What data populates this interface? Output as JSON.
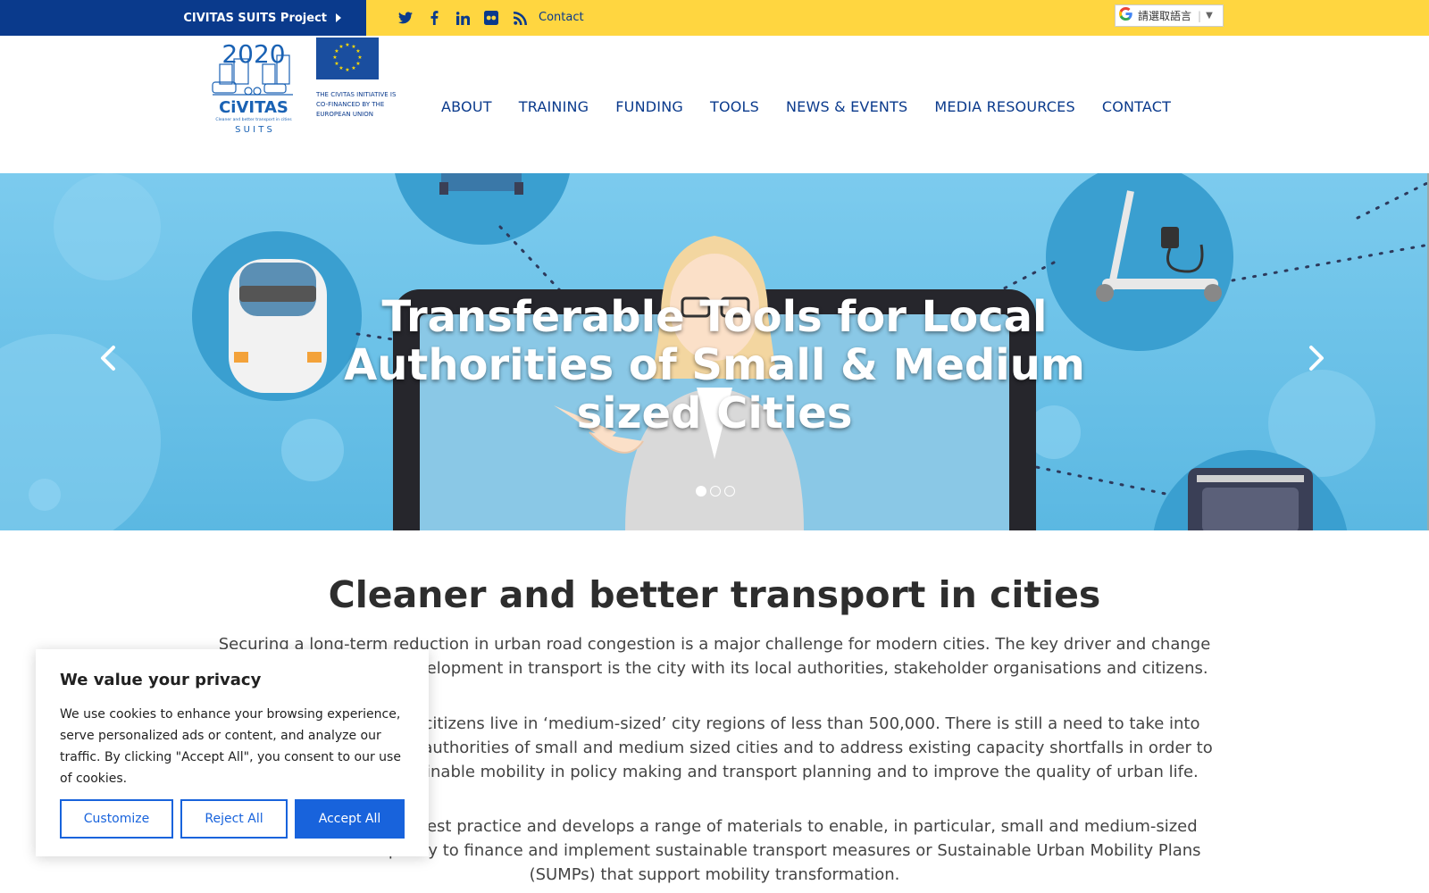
{
  "topbar": {
    "project_label": "CIVITAS SUITS Project",
    "social_icons": [
      "twitter-icon",
      "facebook-icon",
      "linkedin-icon",
      "flickr-icon",
      "rss-icon"
    ],
    "contact_label": "Contact",
    "translate_label": "請選取語言",
    "translate_arrow": "▼"
  },
  "header": {
    "civitas_year": "2020",
    "civitas_name": "CiVITAS",
    "civitas_tagline": "Cleaner and better transport in cities",
    "civitas_sub": "S U I T S",
    "eu_text": "THE CIVITAS INITIATIVE IS CO-FINANCED BY THE EUROPEAN UNION",
    "nav": [
      "ABOUT",
      "TRAINING",
      "FUNDING",
      "TOOLS",
      "NEWS & EVENTS",
      "MEDIA RESOURCES",
      "CONTACT"
    ]
  },
  "hero": {
    "title": "Transferable Tools for Local Authorities of Small & Medium sized Cities",
    "slide_count": 3,
    "active_slide": 1
  },
  "content": {
    "heading": "Cleaner and better transport in cities",
    "p1": "Securing a long-term reduction in urban road congestion is a major challenge for modern cities. The key driver and change agent for sustainable development in transport is the city with its local authorities, stakeholder organisations and citizens.",
    "p2": "Around half of all urban citizens live in ‘medium-sized’ city regions of less than 500,000.  There is still a need to take into account the needs of the authorities of small and medium sized cities and to address existing capacity shortfalls in order to raise the profile of sustainable mobility in policy making and transport planning and to improve the quality of urban life.",
    "p3": "CIVITAS SUITS reviews best practice and develops a range of materials to enable, in particular, small and medium-sized cities to increase capacity to finance and implement sustainable transport measures or Sustainable Urban Mobility Plans (SUMPs) that support mobility transformation."
  },
  "cookie": {
    "title": "We value your privacy",
    "text": "We use cookies to enhance your browsing experience, serve personalized ads or content, and analyze our traffic. By clicking \"Accept All\", you consent to our use of cookies.",
    "customize": "Customize",
    "reject": "Reject All",
    "accept": "Accept All"
  },
  "colors": {
    "topbar_yellow": "#ffd640",
    "brand_blue": "#0a3a8c",
    "cookie_blue": "#1863dc",
    "hero_sky": "#67c1e6"
  }
}
